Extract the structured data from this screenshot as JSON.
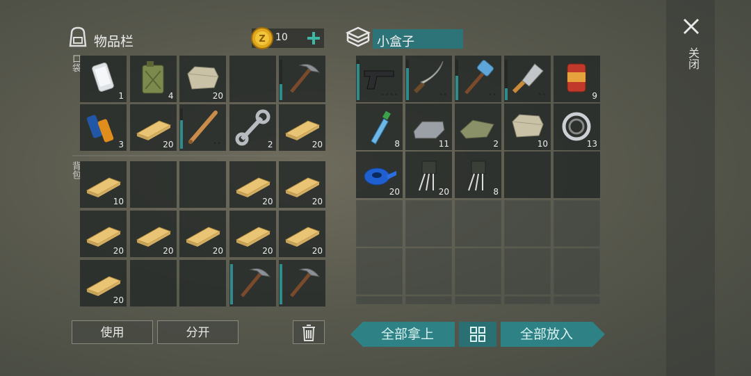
{
  "inventory": {
    "title": "物品栏",
    "coins": "10",
    "pocket_label": "口袋",
    "backpack_label": "背包",
    "pocket_slots": [
      {
        "icon": "phone-icon",
        "count": "1"
      },
      {
        "icon": "jerrycan-icon",
        "count": "4"
      },
      {
        "icon": "stone-icon",
        "count": "20"
      },
      {
        "icon": "",
        "count": ""
      },
      {
        "icon": "pickaxe-icon",
        "count": "",
        "durability": 0.4
      },
      {
        "icon": "batteries-icon",
        "count": "3"
      },
      {
        "icon": "plank-icon",
        "count": "20"
      },
      {
        "icon": "baseball-bat-icon",
        "count": "",
        "durability": 0.7,
        "dots": "••"
      },
      {
        "icon": "wrench-icon",
        "count": "2"
      },
      {
        "icon": "plank-icon",
        "count": "20"
      }
    ],
    "backpack_slots": [
      {
        "icon": "plank-icon",
        "count": "10"
      },
      {
        "icon": "",
        "count": ""
      },
      {
        "icon": "",
        "count": ""
      },
      {
        "icon": "plank-icon",
        "count": "20"
      },
      {
        "icon": "plank-icon",
        "count": "20"
      },
      {
        "icon": "plank-icon",
        "count": "20"
      },
      {
        "icon": "plank-icon",
        "count": "20"
      },
      {
        "icon": "plank-icon",
        "count": "20"
      },
      {
        "icon": "plank-icon",
        "count": "20"
      },
      {
        "icon": "plank-icon",
        "count": "20"
      },
      {
        "icon": "plank-icon",
        "count": "20"
      },
      {
        "icon": "",
        "count": ""
      },
      {
        "icon": "",
        "count": ""
      },
      {
        "icon": "pickaxe-icon",
        "count": "",
        "durability": 1.0
      },
      {
        "icon": "pickaxe-icon",
        "count": "",
        "durability": 1.0
      }
    ],
    "use_label": "使用",
    "split_label": "分开"
  },
  "box": {
    "title": "小盒子",
    "slots": [
      {
        "icon": "pistol-icon",
        "count": "",
        "durability": 0.9,
        "dots": "••••"
      },
      {
        "icon": "machete-icon",
        "count": "",
        "durability": 0.8,
        "dots": "••"
      },
      {
        "icon": "sledgehammer-icon",
        "count": "",
        "durability": 0.6,
        "dots": "••"
      },
      {
        "icon": "cleaver-icon",
        "count": "",
        "durability": 0.3,
        "dots": "••"
      },
      {
        "icon": "canned-food-icon",
        "count": "9"
      },
      {
        "icon": "water-bottle-icon",
        "count": "8"
      },
      {
        "icon": "iron-ingot-icon",
        "count": "11"
      },
      {
        "icon": "cloth-icon",
        "count": "2"
      },
      {
        "icon": "stone-icon",
        "count": "10"
      },
      {
        "icon": "bearing-icon",
        "count": "13"
      },
      {
        "icon": "tape-icon",
        "count": "20"
      },
      {
        "icon": "transistor-icon",
        "count": "20"
      },
      {
        "icon": "transistor-icon",
        "count": "8"
      },
      {
        "icon": "",
        "count": ""
      },
      {
        "icon": "",
        "count": ""
      }
    ],
    "take_all_label": "全部拿上",
    "put_all_label": "全部放入"
  },
  "close_label": "关闭"
}
